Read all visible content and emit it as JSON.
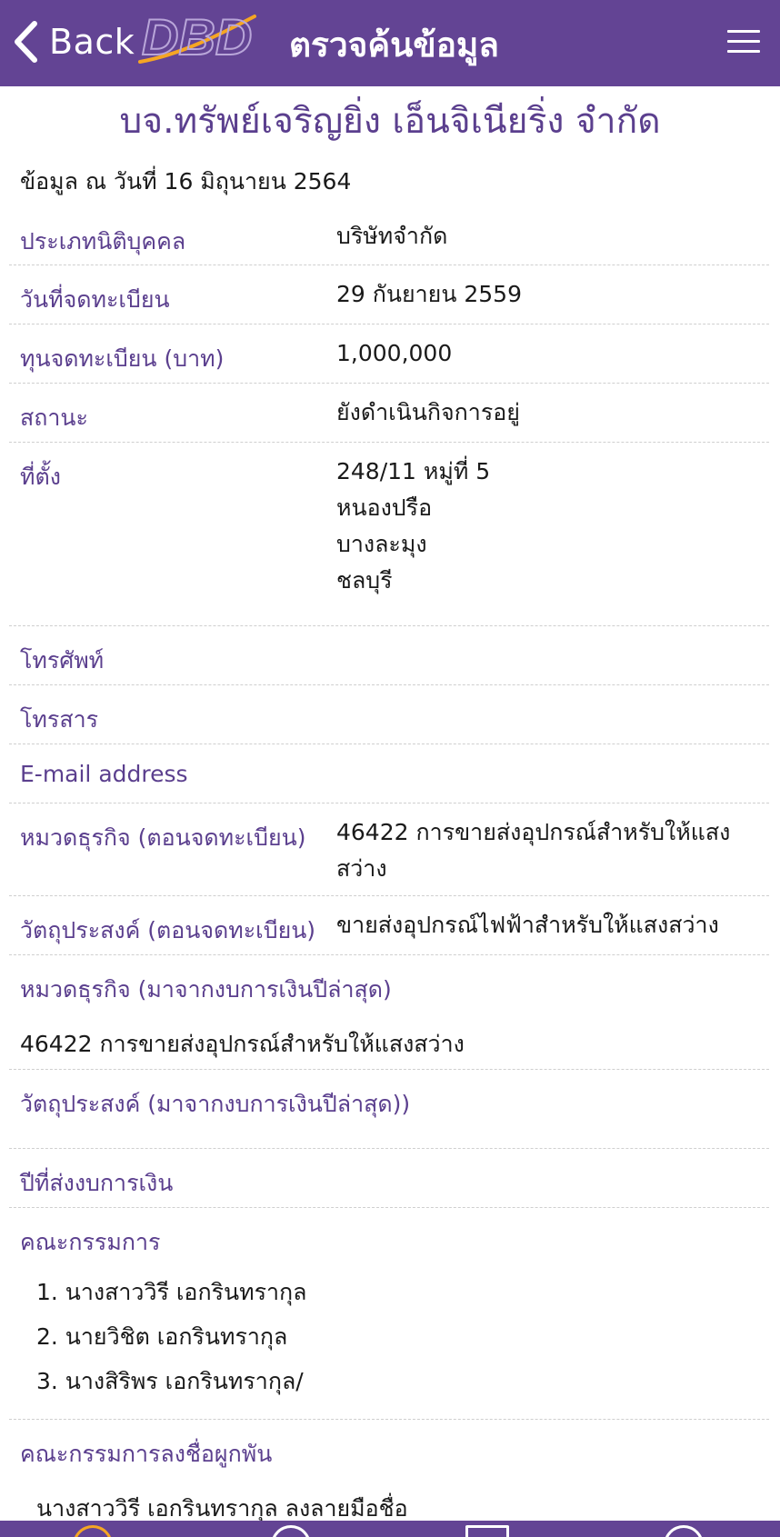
{
  "header": {
    "back_label": "Back",
    "logo_text": "DBD",
    "title": "ตรวจค้นข้อมูล"
  },
  "company_name": "บจ.ทรัพย์เจริญยิ่ง เอ็นจิเนียริ่ง จำกัด",
  "as_of": "ข้อมูล ณ วันที่ 16 มิถุนายน 2564",
  "fields": {
    "type_label": "ประเภทนิติบุคคล",
    "type_value": "บริษัทจำกัด",
    "regdate_label": "วันที่จดทะเบียน",
    "regdate_value": "29 กันยายน 2559",
    "capital_label": "ทุนจดทะเบียน (บาท)",
    "capital_value": "1,000,000",
    "status_label": "สถานะ",
    "status_value": "ยังดำเนินกิจการอยู่",
    "address_label": "ที่ตั้ง",
    "address_lines": [
      "248/11 หมู่ที่ 5",
      "หนองปรือ",
      "บางละมุง",
      "ชลบุรี"
    ],
    "phone_label": "โทรศัพท์",
    "fax_label": "โทรสาร",
    "email_label": "E-mail address",
    "biz_reg_label": "หมวดธุรกิจ (ตอนจดทะเบียน)",
    "biz_reg_value": "46422 การขายส่งอุปกรณ์สำหรับให้แสงสว่าง",
    "obj_reg_label": "วัตถุประสงค์ (ตอนจดทะเบียน)",
    "obj_reg_value": "ขายส่งอุปกรณ์ไฟฟ้าสำหรับให้แสงสว่าง",
    "biz_latest_label": "หมวดธุรกิจ (มาจากงบการเงินปีล่าสุด)",
    "biz_latest_value": "46422 การขายส่งอุปกรณ์สำหรับให้แสงสว่าง",
    "obj_latest_label": "วัตถุประสงค์ (มาจากงบการเงินปีล่าสุด))",
    "fs_year_label": "ปีที่ส่งงบการเงิน",
    "directors_label": "คณะกรรมการ",
    "directors": [
      "1. นางสาววิรี เอกรินทรากุล",
      "2. นายวิชิต เอกรินทรากุล",
      "3. นางสิริพร เอกรินทรากุล/"
    ],
    "signatory_label": "คณะกรรมการลงชื่อผูกพัน",
    "signatory_value": "นางสาววิรี เอกรินทรากุล ลงลายมือชื่อ"
  },
  "colors": {
    "brand_purple": "#634494",
    "label_purple": "#5b3f8e",
    "logo_orange": "#f5a623"
  },
  "icons": [
    "chevron-left-icon",
    "hamburger-menu-icon",
    "dbd-logo"
  ]
}
